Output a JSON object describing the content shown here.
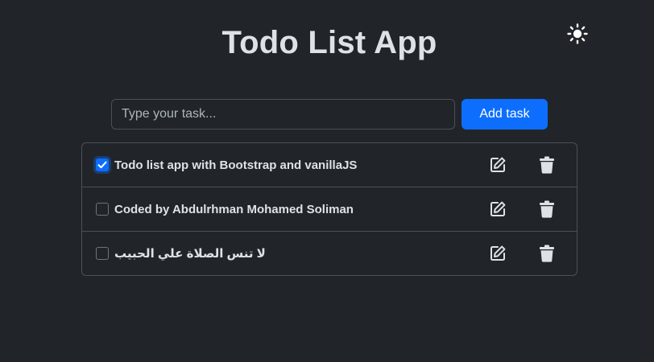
{
  "app": {
    "title": "Todo List App",
    "theme_icon": "sun-icon"
  },
  "form": {
    "placeholder": "Type your task...",
    "value": "",
    "add_label": "Add task"
  },
  "tasks": [
    {
      "text": "Todo list app with Bootstrap and vanillaJS",
      "done": true
    },
    {
      "text": "Coded by Abdulrhman Mohamed Soliman",
      "done": false
    },
    {
      "text": "لا تنس الصلاة علي الحبيب",
      "done": false
    }
  ],
  "icons": {
    "edit": "pencil-square-icon",
    "delete": "trash-icon"
  },
  "colors": {
    "background": "#212529",
    "text": "#dee2e6",
    "border": "#495057",
    "primary": "#0d6efd"
  }
}
